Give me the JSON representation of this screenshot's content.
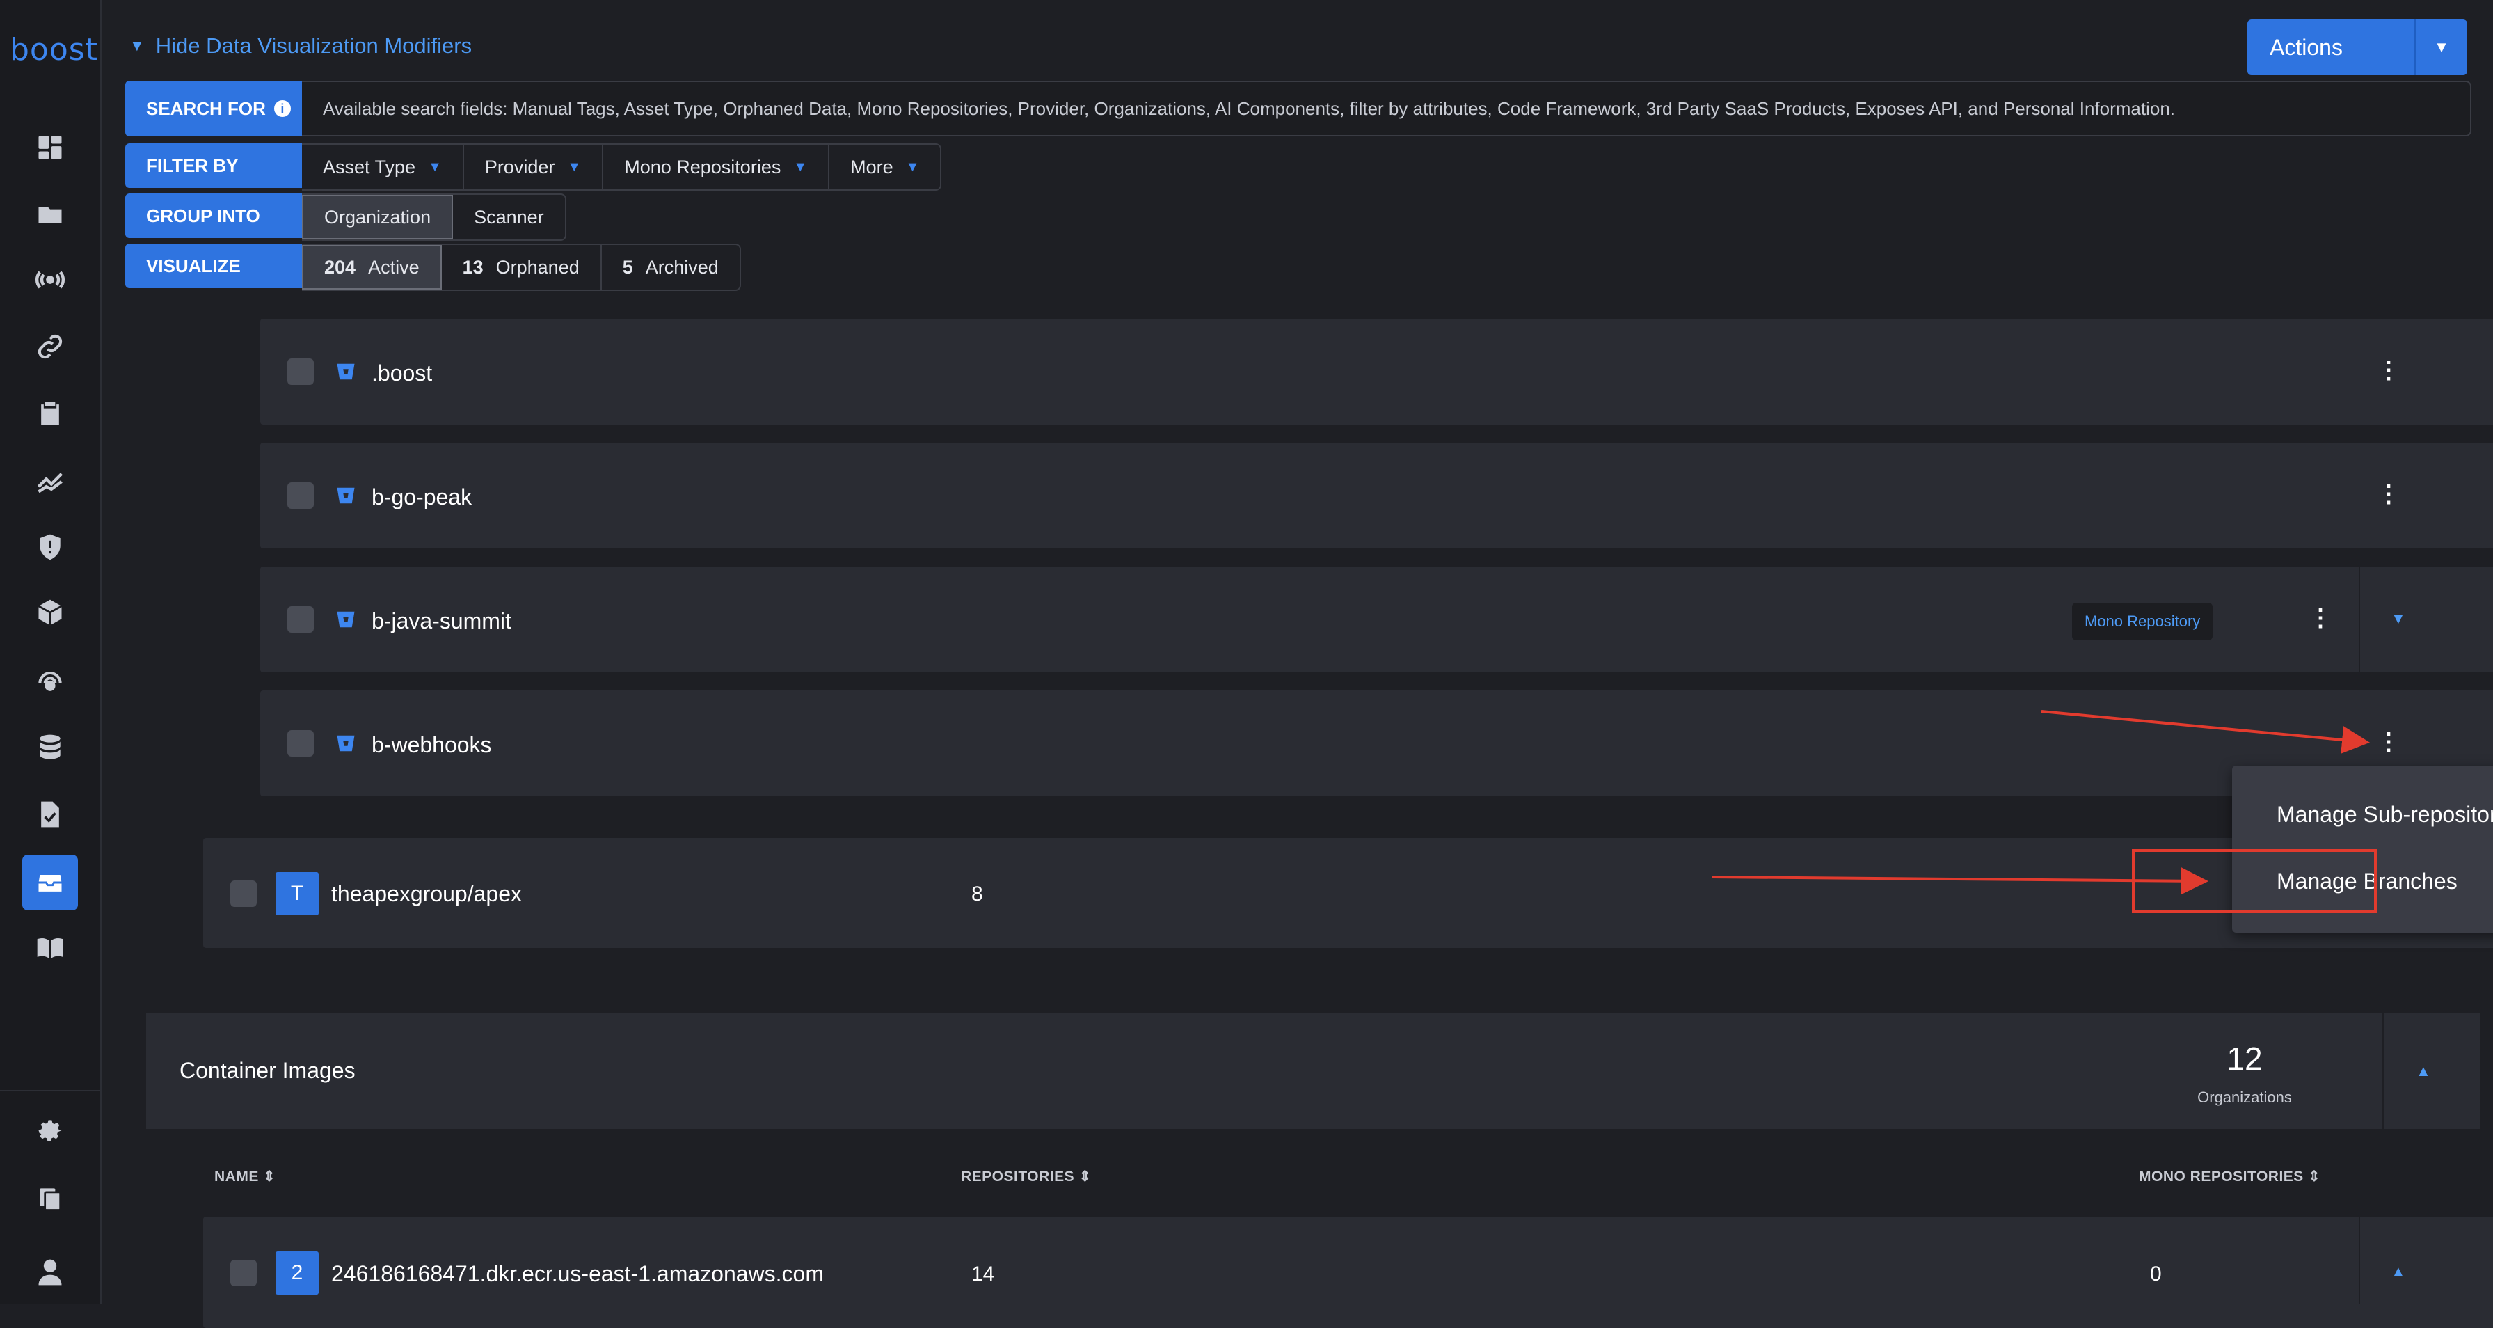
{
  "sidebar": {
    "logo": "boost",
    "icons": [
      "dashboard-icon",
      "folder-icon",
      "broadcast-icon",
      "link-icon",
      "clipboard-icon",
      "trend-icon",
      "shield-alert-icon",
      "cube-icon",
      "radar-icon",
      "database-icon",
      "document-check-icon",
      "inbox-icon",
      "book-icon",
      "gear-icon",
      "copy-icon",
      "user-icon"
    ]
  },
  "header": {
    "hide_modifiers": "Hide Data Visualization Modifiers",
    "actions_label": "Actions"
  },
  "search": {
    "label": "SEARCH FOR",
    "help": "Available search fields: Manual Tags, Asset Type, Orphaned Data, Mono Repositories, Provider, Organizations, AI Components, filter by attributes, Code Framework, 3rd Party SaaS Products, Exposes API, and Personal Information."
  },
  "filter": {
    "label": "FILTER BY",
    "items": [
      "Asset Type",
      "Provider",
      "Mono Repositories",
      "More"
    ]
  },
  "group": {
    "label": "GROUP INTO",
    "items": [
      "Organization",
      "Scanner"
    ],
    "selected": "Organization"
  },
  "visualize": {
    "label": "VISUALIZE",
    "items": [
      {
        "count": "204",
        "label": "Active"
      },
      {
        "count": "13",
        "label": "Orphaned"
      },
      {
        "count": "5",
        "label": "Archived"
      }
    ]
  },
  "repos": [
    {
      "name": ".boost"
    },
    {
      "name": "b-go-peak"
    },
    {
      "name": "b-java-summit",
      "tag": "Mono Repository"
    },
    {
      "name": "b-webhooks"
    }
  ],
  "org_row": {
    "avatar": "T",
    "name": "theapexgroup/apex",
    "count": "8"
  },
  "context_menu": {
    "items": [
      "Manage Sub-repositories",
      "Manage Branches"
    ]
  },
  "container_section": {
    "title": "Container Images",
    "count": "12",
    "count_label": "Organizations",
    "columns": [
      "NAME",
      "REPOSITORIES",
      "MONO REPOSITORIES"
    ],
    "rows": [
      {
        "avatar": "2",
        "name": "246186168471.dkr.ecr.us-east-1.amazonaws.com",
        "repositories": "14",
        "mono": "0"
      }
    ]
  },
  "colors": {
    "accent": "#2f74e0",
    "annotation": "#e23b2e",
    "background": "#1e1f24"
  }
}
